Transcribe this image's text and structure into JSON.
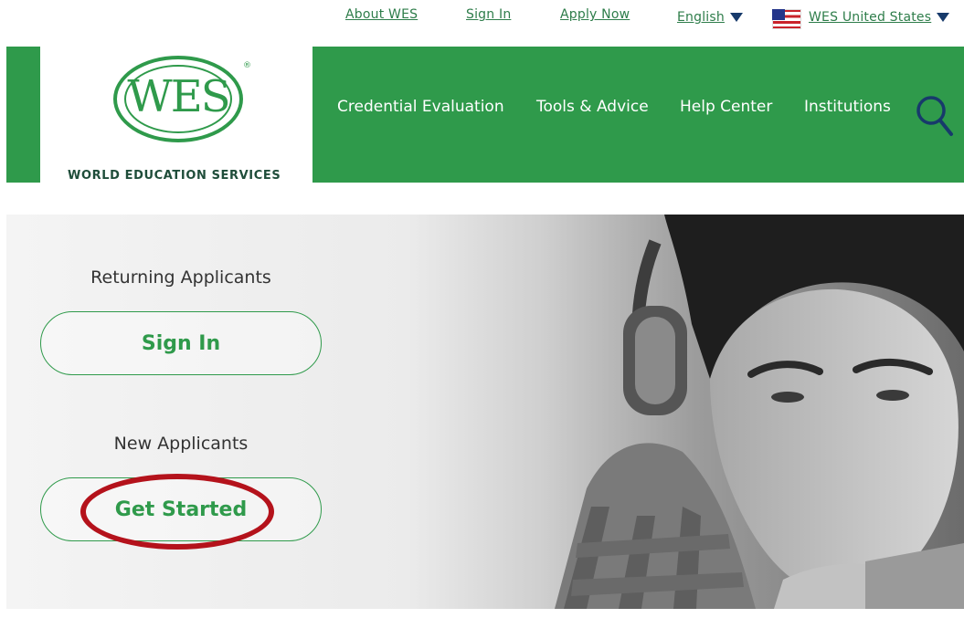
{
  "utility_nav": {
    "about": "About WES",
    "sign_in": "Sign In",
    "apply": "Apply Now",
    "language": "English",
    "region": "WES United States"
  },
  "logo": {
    "wordmark": "WES",
    "registered": "®",
    "tagline": "WORLD EDUCATION SERVICES"
  },
  "main_nav": {
    "items": [
      "Credential Evaluation",
      "Tools & Advice",
      "Help Center",
      "Institutions"
    ],
    "search_icon": "search-icon"
  },
  "hero": {
    "returning_label": "Returning Applicants",
    "sign_in_button": "Sign In",
    "new_label": "New Applicants",
    "get_started_button": "Get Started"
  },
  "colors": {
    "brand_green": "#2f9a4b",
    "highlight_red": "#b4121b",
    "caret_blue": "#173a6b"
  }
}
